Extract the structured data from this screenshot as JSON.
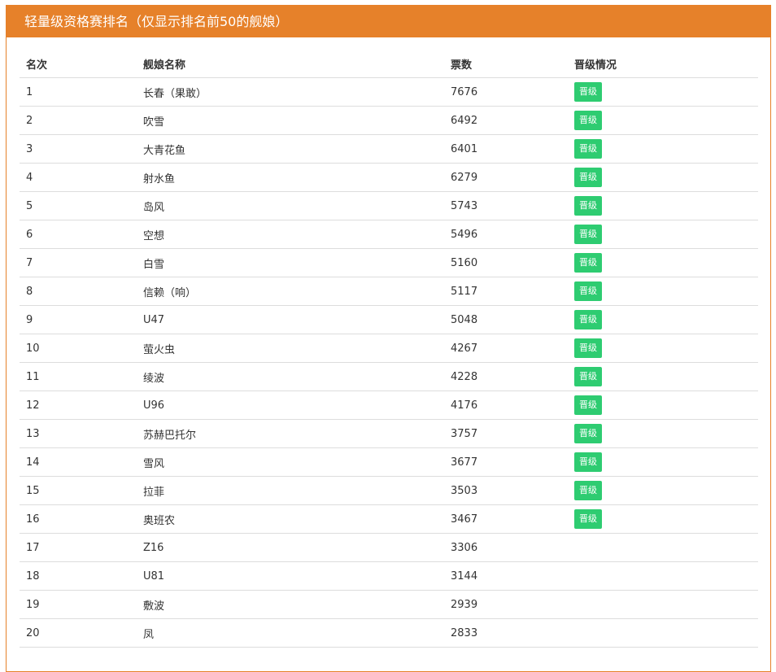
{
  "panel": {
    "title": "轻量级资格赛排名（仅显示排名前50的舰娘）"
  },
  "colors": {
    "header_bg": "#e6812a",
    "badge_bg": "#2ecc71"
  },
  "table": {
    "columns": [
      "名次",
      "舰娘名称",
      "票数",
      "晋级情况"
    ],
    "rows": [
      {
        "rank": "1",
        "name": "长春（果敢）",
        "votes": "7676",
        "status": "晋级"
      },
      {
        "rank": "2",
        "name": "吹雪",
        "votes": "6492",
        "status": "晋级"
      },
      {
        "rank": "3",
        "name": "大青花鱼",
        "votes": "6401",
        "status": "晋级"
      },
      {
        "rank": "4",
        "name": "射水鱼",
        "votes": "6279",
        "status": "晋级"
      },
      {
        "rank": "5",
        "name": "岛风",
        "votes": "5743",
        "status": "晋级"
      },
      {
        "rank": "6",
        "name": "空想",
        "votes": "5496",
        "status": "晋级"
      },
      {
        "rank": "7",
        "name": "白雪",
        "votes": "5160",
        "status": "晋级"
      },
      {
        "rank": "8",
        "name": "信赖（响）",
        "votes": "5117",
        "status": "晋级"
      },
      {
        "rank": "9",
        "name": "U47",
        "votes": "5048",
        "status": "晋级"
      },
      {
        "rank": "10",
        "name": "萤火虫",
        "votes": "4267",
        "status": "晋级"
      },
      {
        "rank": "11",
        "name": "绫波",
        "votes": "4228",
        "status": "晋级"
      },
      {
        "rank": "12",
        "name": "U96",
        "votes": "4176",
        "status": "晋级"
      },
      {
        "rank": "13",
        "name": "苏赫巴托尔",
        "votes": "3757",
        "status": "晋级"
      },
      {
        "rank": "14",
        "name": "雪风",
        "votes": "3677",
        "status": "晋级"
      },
      {
        "rank": "15",
        "name": "拉菲",
        "votes": "3503",
        "status": "晋级"
      },
      {
        "rank": "16",
        "name": "奥班农",
        "votes": "3467",
        "status": "晋级"
      },
      {
        "rank": "17",
        "name": "Z16",
        "votes": "3306",
        "status": ""
      },
      {
        "rank": "18",
        "name": "U81",
        "votes": "3144",
        "status": ""
      },
      {
        "rank": "19",
        "name": "敷波",
        "votes": "2939",
        "status": ""
      },
      {
        "rank": "20",
        "name": "凤",
        "votes": "2833",
        "status": ""
      }
    ]
  }
}
